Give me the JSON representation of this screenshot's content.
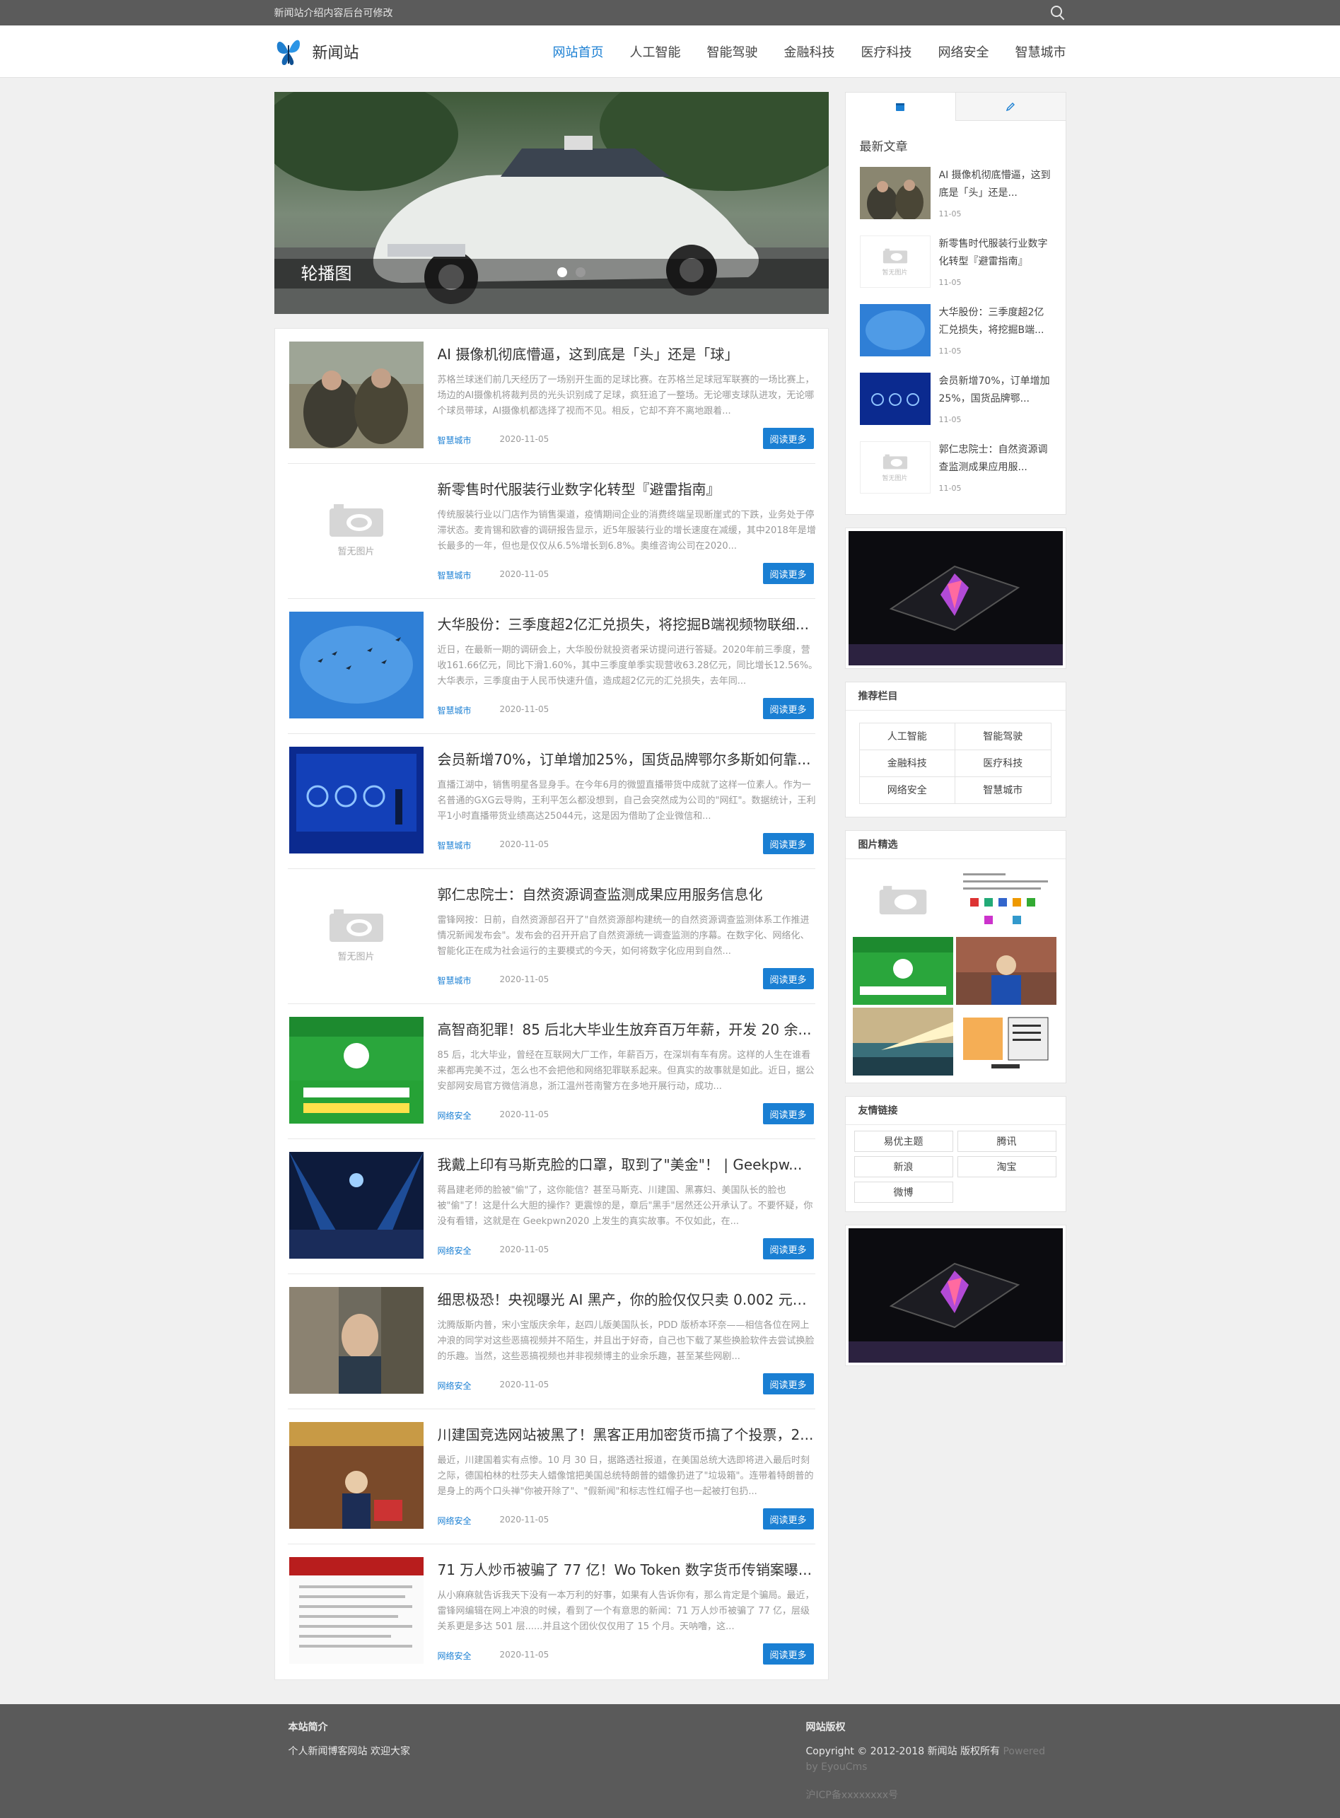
{
  "topbar": {
    "notice": "新闻站介绍内容后台可修改",
    "search_icon": "search-icon"
  },
  "header": {
    "site_name": "新闻站",
    "nav": [
      "网站首页",
      "人工智能",
      "智能驾驶",
      "金融科技",
      "医疗科技",
      "网络安全",
      "智慧城市"
    ]
  },
  "banner": {
    "caption": "轮播图"
  },
  "no_image_text": "暂无图片",
  "more_label": "阅读更多",
  "articles": [
    {
      "title": "AI 摄像机彻底懵逼，这到底是「头」还是「球」",
      "summary": "苏格兰球迷们前几天经历了一场别开生面的足球比赛。在苏格兰足球冠军联赛的一场比赛上，场边的AI摄像机将裁判员的光头识别成了足球，疯狂追了一整场。无论哪支球队进攻，无论哪个球员带球，AI摄像机都选择了视而不见。相反，它却不弃不离地跟着...",
      "category": "智慧城市",
      "date": "2020-11-05"
    },
    {
      "title": "新零售时代服装行业数字化转型『避雷指南』",
      "summary": "传统服装行业以门店作为销售渠道，疫情期间企业的消费终端呈现断崖式的下跌，业务处于停滞状态。麦肯锡和欧睿的调研报告显示，近5年服装行业的增长速度在减缓，其中2018年是增长最多的一年，但也是仅仅从6.5%增长到6.8%。奥维咨询公司在2020...",
      "category": "智慧城市",
      "date": "2020-11-05"
    },
    {
      "title": "大华股份：三季度超2亿汇兑损失，将挖掘B端视频物联细...",
      "summary": "近日，在最新一期的调研会上，大华股份就投资者采访提问进行答疑。2020年前三季度，营收161.66亿元，同比下滑1.60%，其中三季度单季实现营收63.28亿元，同比增长12.56%。大华表示，三季度由于人民币快速升值，造成超2亿元的汇兑损失，去年同...",
      "category": "智慧城市",
      "date": "2020-11-05"
    },
    {
      "title": "会员新增70%，订单增加25%，国货品牌鄂尔多斯如何靠...",
      "summary": "直播江湖中，销售明星各显身手。在今年6月的微盟直播带货中成就了这样一位素人。作为一名普通的GXG云导购，王利平怎么都没想到，自己会突然成为公司的\"网红\"。数据统计，王利平1小时直播带货业绩高达25044元，这是因为借助了企业微信和...",
      "category": "智慧城市",
      "date": "2020-11-05"
    },
    {
      "title": "郭仁忠院士：自然资源调查监测成果应用服务信息化",
      "summary": "雷锋网按：日前，自然资源部召开了\"自然资源部构建统一的自然资源调查监测体系工作推进情况新闻发布会\"。发布会的召开开启了自然资源统一调查监测的序幕。在数字化、网络化、智能化正在成为社会运行的主要模式的今天，如何将数字化应用到自然...",
      "category": "智慧城市",
      "date": "2020-11-05"
    },
    {
      "title": "高智商犯罪！85 后北大毕业生放弃百万年薪，开发 20 余...",
      "summary": "85 后，北大毕业，曾经在互联网大厂工作，年薪百万，在深圳有车有房。这样的人生在谁看来都再完美不过，怎么也不会把他和网络犯罪联系起来。但真实的故事就是如此。近日，据公安部网安局官方微信消息，浙江温州苍南警方在多地开展行动，成功...",
      "category": "网络安全",
      "date": "2020-11-05"
    },
    {
      "title": "我戴上印有马斯克脸的口罩，取到了\"美金\"！ | Geekpw...",
      "summary": "蒋昌建老师的脸被\"偷\"了，这你能信？甚至马斯克、川建国、黑寡妇、美国队长的脸也被\"偷\"了！这是什么大胆的操作？更震惊的是，章后\"黑手\"居然还公开承认了。不要怀疑，你没有看错，这就是在 Geekpwn2020 上发生的真实故事。不仅如此，在...",
      "category": "网络安全",
      "date": "2020-11-05"
    },
    {
      "title": "细思极恐！央视曝光 AI 黑产，你的脸仅仅只卖 0.002 元，...",
      "summary": "沈腾版斯内普，宋小宝版庆余年，赵四儿版美国队长，PDD 版桥本环奈——相信各位在网上冲浪的同学对这些恶搞视频并不陌生，并且出于好奇，自己也下载了某些换脸软件去尝试换脸的乐趣。当然，这些恶搞视频也并非视频博主的业余乐趣，甚至某些网剧...",
      "category": "网络安全",
      "date": "2020-11-05"
    },
    {
      "title": "川建国竞选网站被黑了！黑客正用加密货币搞了个投票，2...",
      "summary": "最近，川建国着实有点惨。10 月 30 日，据路透社报道，在美国总统大选即将进入最后时刻之际，德国柏林的杜莎夫人蜡像馆把美国总统特朗普的蜡像扔进了\"垃圾箱\"。连带着特朗普的是身上的两个口头禅\"你被开除了\"、\"假新闻\"和标志性红帽子也一起被打包扔...",
      "category": "网络安全",
      "date": "2020-11-05"
    },
    {
      "title": "71 万人炒币被骗了 77 亿！Wo Token 数字货币传销案曝...",
      "summary": "从小麻麻就告诉我天下没有一本万利的好事，如果有人告诉你有，那么肯定是个骗局。最近，雷锋网编辑在网上冲浪的时候，看到了一个有意思的新闻：71 万人炒币被骗了 77 亿，层级关系更是多达 501 层......并且这个团伙仅仅用了 15 个月。天呐噜，这...",
      "category": "网络安全",
      "date": "2020-11-05"
    }
  ],
  "sidebar": {
    "recent_heading": "最新文章",
    "tab_icons": [
      "calendar-icon",
      "pencil-icon"
    ],
    "recent": [
      {
        "title": "AI 摄像机彻底懵逼，这到底是「头」还是...",
        "date": "11-05"
      },
      {
        "title": "新零售时代服装行业数字化转型『避雷指南』",
        "date": "11-05"
      },
      {
        "title": "大华股份：三季度超2亿汇兑损失，将挖掘B端...",
        "date": "11-05"
      },
      {
        "title": "会员新增70%，订单增加25%，国货品牌鄂...",
        "date": "11-05"
      },
      {
        "title": "郭仁忠院士：自然资源调查监测成果应用服...",
        "date": "11-05"
      }
    ],
    "recommend_heading": "推荐栏目",
    "recommend": [
      "人工智能",
      "智能驾驶",
      "金融科技",
      "医疗科技",
      "网络安全",
      "智慧城市"
    ],
    "pics_heading": "图片精选",
    "links_heading": "友情链接",
    "links": [
      "易优主题",
      "腾讯",
      "新浪",
      "淘宝",
      "微博"
    ]
  },
  "footer": {
    "about_heading": "本站简介",
    "about_text": "个人新闻博客网站 欢迎大家",
    "copyright_heading": "网站版权",
    "copyright_text": "Copyright © 2012-2018 新闻站 版权所有",
    "powered_text": "Powered by EyouCms",
    "icp_text": "沪ICP备xxxxxxxx号"
  },
  "colors": {
    "accent": "#1a7fd3",
    "topbar": "#5b5b5b",
    "footer": "#5a5a5a"
  }
}
